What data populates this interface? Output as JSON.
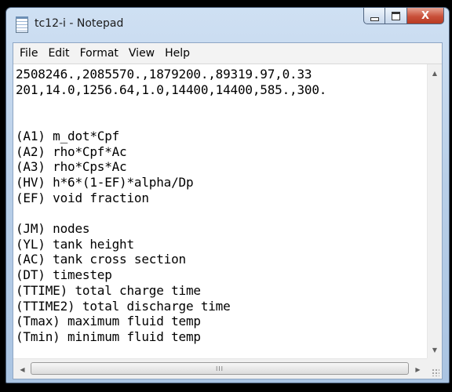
{
  "window": {
    "title": "tc12-i - Notepad",
    "close_glyph": "X"
  },
  "menu": [
    "File",
    "Edit",
    "Format",
    "View",
    "Help"
  ],
  "document": {
    "text": "2508246.,2085570.,1879200.,89319.97,0.33\n201,14.0,1256.64,1.0,14400,14400,585.,300.\n\n\n(A1) m_dot*Cpf\n(A2) rho*Cpf*Ac\n(A3) rho*Cps*Ac\n(HV) h*6*(1-EF)*alpha/Dp\n(EF) void fraction\n\n(JM) nodes\n(YL) tank height\n(AC) tank cross section\n(DT) timestep\n(TTIME) total charge time\n(TTIME2) total discharge time\n(Tmax) maximum fluid temp\n(Tmin) minimum fluid temp"
  },
  "scrollbars": {
    "up_arrow": "▲",
    "down_arrow": "▼",
    "left_arrow": "◀",
    "right_arrow": "▶",
    "grip": "III"
  }
}
